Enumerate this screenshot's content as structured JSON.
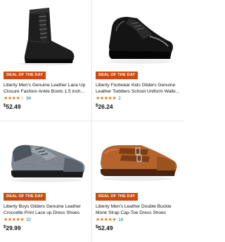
{
  "products": [
    {
      "deal_badge": "DEAL OF THE DAY",
      "title": "Liberty Men's Genuine Leather Lace Up Closure Fashion Ankle Boots 1.5 inch...",
      "rating": 4,
      "stars": "★★★★☆",
      "review_count": "94",
      "price_symbol": "$",
      "price_amount": "52.49",
      "image_icon": "black-leather-ankle-boot"
    },
    {
      "deal_badge": "DEAL OF THE DAY",
      "title": "Liberty Footwear Kids Gliders Genuine Leather Toddlers School Uniform Walki...",
      "rating": 4.5,
      "stars": "★★★★★",
      "review_count": "2",
      "price_symbol": "$",
      "price_amount": "26.24",
      "image_icon": "black-patent-oxford-shoe"
    },
    {
      "deal_badge": "DEAL OF THE DAY",
      "title": "Liberty Boys Gliders Genuine Leather Crocodile Print Lace up Dress Shoes",
      "rating": 4.5,
      "stars": "★★★★★",
      "review_count": "32",
      "price_symbol": "$",
      "price_amount": "29.99",
      "image_icon": "grey-croc-print-oxford-shoe"
    },
    {
      "deal_badge": "DEAL OF THE DAY",
      "title": "Liberty Men's Leather Double Buckle Monk Strap Cap-Toe Dress Shoes",
      "rating": 4.5,
      "stars": "★★★★★",
      "review_count": "18",
      "price_symbol": "$",
      "price_amount": "52.49",
      "image_icon": "brown-monk-strap-shoe"
    }
  ],
  "colors": {
    "badge_bg": "#cc4b0f",
    "star": "#de7921",
    "link": "#007185",
    "brown_leather": "#b5652b",
    "grey_leather": "#7f8891"
  }
}
